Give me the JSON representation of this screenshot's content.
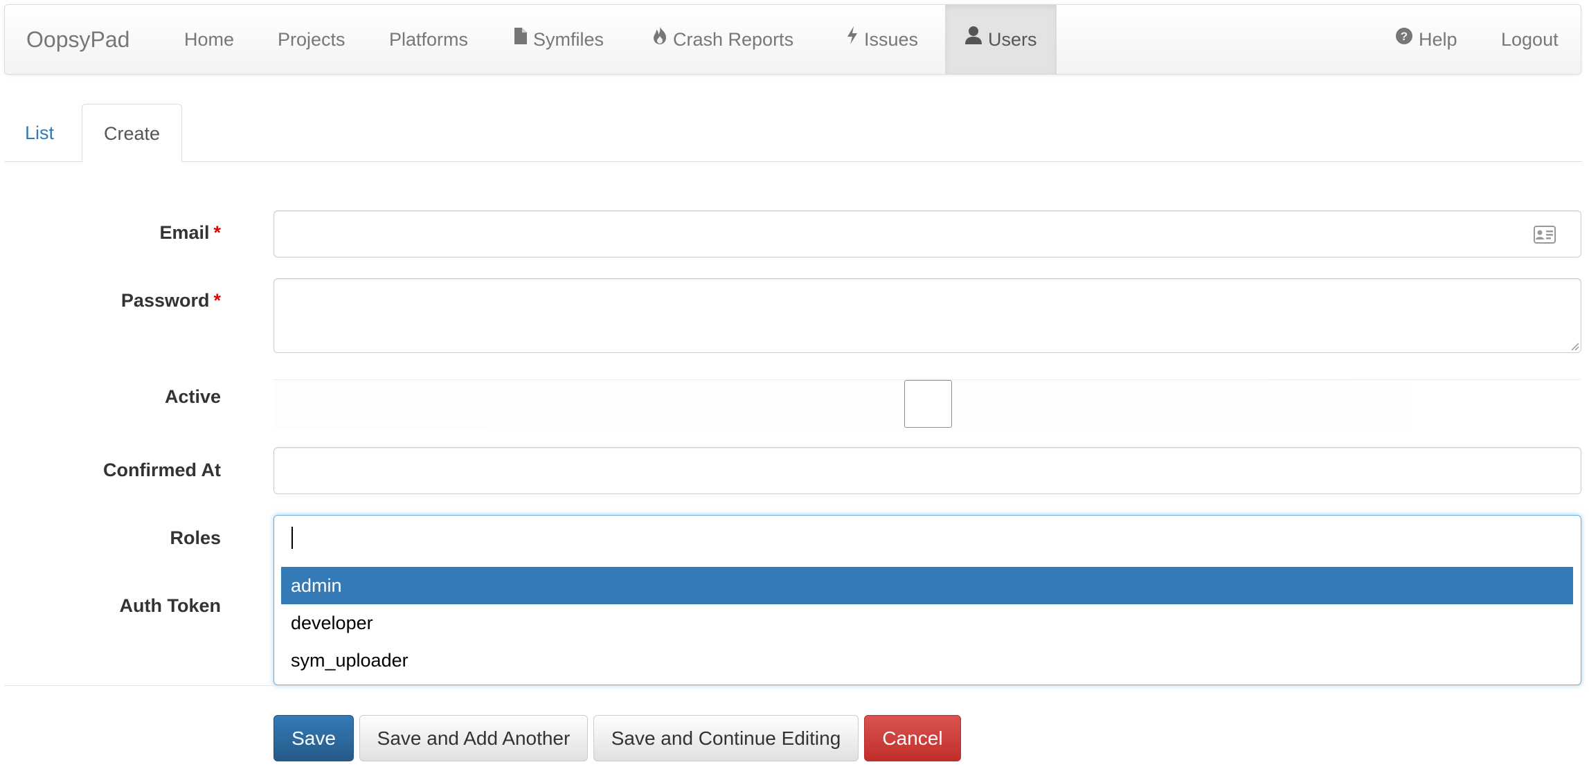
{
  "navbar": {
    "brand": "OopsyPad",
    "items": [
      {
        "label": "Home",
        "icon": ""
      },
      {
        "label": "Projects",
        "icon": ""
      },
      {
        "label": "Platforms",
        "icon": ""
      },
      {
        "label": "Symfiles",
        "icon": "file-icon"
      },
      {
        "label": "Crash Reports",
        "icon": "fire-icon"
      },
      {
        "label": "Issues",
        "icon": "flash-icon"
      },
      {
        "label": "Users",
        "icon": "user-icon",
        "active": true
      }
    ],
    "right_items": [
      {
        "label": "Help",
        "icon": "question-sign-icon"
      },
      {
        "label": "Logout",
        "icon": ""
      }
    ]
  },
  "tabs": [
    {
      "label": "List",
      "active": false
    },
    {
      "label": "Create",
      "active": true
    }
  ],
  "form": {
    "email": {
      "label": "Email",
      "required_mark": "*",
      "value": "",
      "icon": "contact-card-icon"
    },
    "password": {
      "label": "Password",
      "required_mark": "*",
      "value": ""
    },
    "active": {
      "label": "Active",
      "checked": false
    },
    "confirmed_at": {
      "label": "Confirmed At",
      "value": ""
    },
    "roles": {
      "label": "Roles",
      "search_value": "",
      "options": [
        "admin",
        "developer",
        "sym_uploader"
      ],
      "highlighted": "admin"
    },
    "auth_token": {
      "label": "Auth Token",
      "value": ""
    }
  },
  "actions": {
    "save": "Save",
    "save_add_another": "Save and Add Another",
    "save_continue": "Save and Continue Editing",
    "cancel": "Cancel"
  },
  "colors": {
    "primary": "#337ab7",
    "danger": "#d9534f",
    "required": "#e00000",
    "focus": "#66afe9"
  }
}
